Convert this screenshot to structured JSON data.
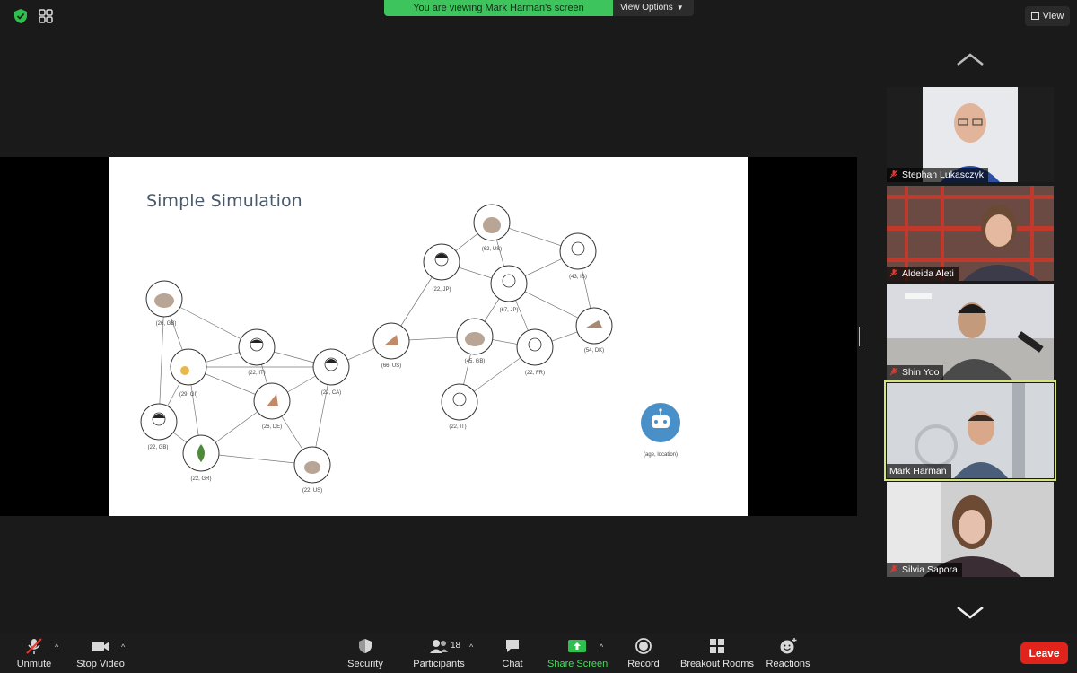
{
  "meeting": {
    "banner_text": "You are viewing Mark Harman's screen",
    "view_options_label": "View Options",
    "view_label": "View"
  },
  "slide": {
    "title": "Simple Simulation",
    "legend_label": "(age, location)",
    "nodes": [
      {
        "label": "(62, US)"
      },
      {
        "label": "(43, IS)"
      },
      {
        "label": "(22, JP)"
      },
      {
        "label": "(67, JP)"
      },
      {
        "label": "(54, DK)"
      },
      {
        "label": "(66, US)"
      },
      {
        "label": "(45, GB)"
      },
      {
        "label": "(22, FR)"
      },
      {
        "label": "(22, IT)"
      },
      {
        "label": "(26, GB)"
      },
      {
        "label": "(22, IT)"
      },
      {
        "label": "(29, GI)"
      },
      {
        "label": "(22, CA)"
      },
      {
        "label": "(26, DE)"
      },
      {
        "label": "(22, GB)"
      },
      {
        "label": "(22, GR)"
      },
      {
        "label": "(22, US)"
      }
    ]
  },
  "participants": [
    {
      "name": "Stephan Lukasczyk",
      "muted": true
    },
    {
      "name": "Aldeida Aleti",
      "muted": true
    },
    {
      "name": "Shin Yoo",
      "muted": true
    },
    {
      "name": "Mark Harman",
      "muted": false,
      "active_speaker": true
    },
    {
      "name": "Silvia Sapora",
      "muted": true
    }
  ],
  "toolbar": {
    "unmute": "Unmute",
    "stop_video": "Stop Video",
    "security": "Security",
    "participants": "Participants",
    "participants_count": "18",
    "chat": "Chat",
    "share_screen": "Share Screen",
    "record": "Record",
    "breakout_rooms": "Breakout Rooms",
    "reactions": "Reactions",
    "leave": "Leave"
  },
  "colors": {
    "banner": "#3ec45c",
    "leave": "#e0241c",
    "share_screen": "#4cd964",
    "active_speaker_outline": "#d6e57a",
    "robot_node": "#4a90c8"
  }
}
